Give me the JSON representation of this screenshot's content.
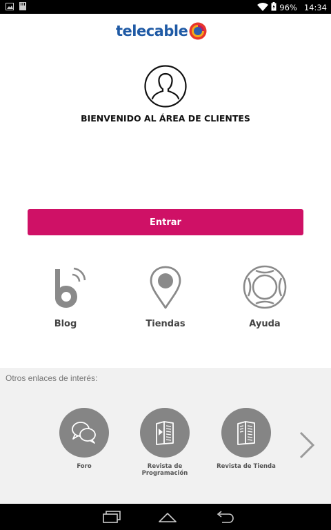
{
  "status_bar": {
    "battery": "96%",
    "time": "14:34",
    "icons": [
      "image-icon",
      "sd-card-icon",
      "wifi-icon",
      "battery-icon"
    ]
  },
  "header": {
    "logo_text": "telecable"
  },
  "welcome": {
    "title": "BIENVENIDO AL ÁREA DE CLIENTES"
  },
  "actions": {
    "enter_label": "Entrar"
  },
  "quick_links": [
    {
      "label": "Blog",
      "icon": "blog-icon"
    },
    {
      "label": "Tiendas",
      "icon": "map-pin-icon"
    },
    {
      "label": "Ayuda",
      "icon": "lifebuoy-icon"
    }
  ],
  "other_links": {
    "title": "Otros enlaces de interés:",
    "items": [
      {
        "label": "Foro",
        "icon": "chat-bubbles-icon"
      },
      {
        "label": "Revista de Programación",
        "line1": "Revista de",
        "line2": "Programación",
        "icon": "magazine-play-icon"
      },
      {
        "label": "Revista de Tienda",
        "icon": "magazine-icon"
      }
    ]
  },
  "colors": {
    "brand_blue": "#1f5aa5",
    "accent": "#cf1166",
    "icon_gray": "#8a8a8a"
  },
  "nav_bar": {
    "icons": [
      "recent-apps-icon",
      "home-icon",
      "back-icon"
    ]
  }
}
